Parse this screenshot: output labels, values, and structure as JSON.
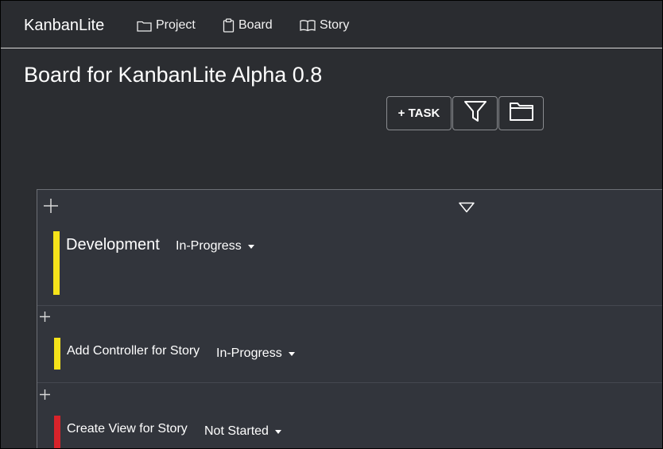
{
  "navbar": {
    "brand": "KanbanLite",
    "items": [
      {
        "label": "Project",
        "icon": "folder-icon"
      },
      {
        "label": "Board",
        "icon": "clipboard-icon"
      },
      {
        "label": "Story",
        "icon": "book-icon"
      }
    ]
  },
  "page": {
    "title": "Board for KanbanLite Alpha 0.8"
  },
  "toolbar": {
    "add_task_label": "+ TASK",
    "filter_icon": "filter-icon",
    "open_icon": "folder-open-icon"
  },
  "board": {
    "story": {
      "title": "Development",
      "status": "In-Progress",
      "color": "#f5e31a"
    },
    "tasks": [
      {
        "title": "Add Controller for Story",
        "status": "In-Progress",
        "color": "#f5e31a"
      },
      {
        "title": "Create View for Story",
        "status": "Not Started",
        "color": "#d9232a"
      }
    ]
  },
  "colors": {
    "background": "#2b2d31",
    "board": "#32353c",
    "in_progress": "#f5e31a",
    "not_started": "#d9232a"
  }
}
